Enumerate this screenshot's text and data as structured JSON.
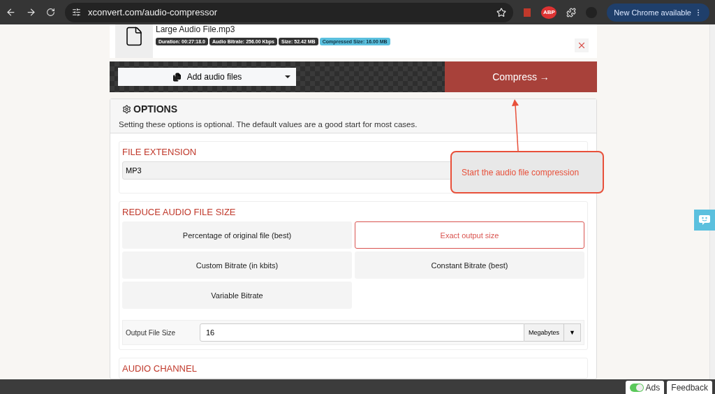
{
  "browser": {
    "url": "xconvert.com/audio-compressor",
    "update_button": "New Chrome available",
    "extension_badge": "ABP"
  },
  "file": {
    "name": "Large Audio File.mp3",
    "badges": [
      {
        "text": "Duration: 00:27:18.0",
        "kind": "info"
      },
      {
        "text": "Audio Bitrate: 256.00 Kbps",
        "kind": "info"
      },
      {
        "text": "Size: 52.42 MB",
        "kind": "info"
      },
      {
        "text": "Compressed Size: 16.00 MB",
        "kind": "result"
      }
    ]
  },
  "actions": {
    "add_files": "Add audio files",
    "compress": "Compress →"
  },
  "options": {
    "title": "OPTIONS",
    "description": "Setting these options is optional. The default values are a good start for most cases.",
    "file_extension": {
      "label": "FILE EXTENSION",
      "value": "MP3"
    },
    "reduce": {
      "label": "REDUCE AUDIO FILE SIZE",
      "methods": [
        {
          "label": "Percentage of original file (best)",
          "selected": false
        },
        {
          "label": "Exact output size",
          "selected": true
        },
        {
          "label": "Custom Bitrate (in kbits)",
          "selected": false
        },
        {
          "label": "Constant Bitrate (best)",
          "selected": false
        },
        {
          "label": "Variable Bitrate",
          "selected": false
        }
      ],
      "output_size": {
        "label": "Output File Size",
        "value": "16",
        "unit": "Megabytes",
        "caret": "▼"
      }
    },
    "audio_channel": {
      "label": "AUDIO CHANNEL"
    }
  },
  "callout": {
    "text": "Start the audio file compression"
  },
  "footer": {
    "ads_label": "Ads",
    "ads_on": true,
    "feedback": "Feedback"
  }
}
